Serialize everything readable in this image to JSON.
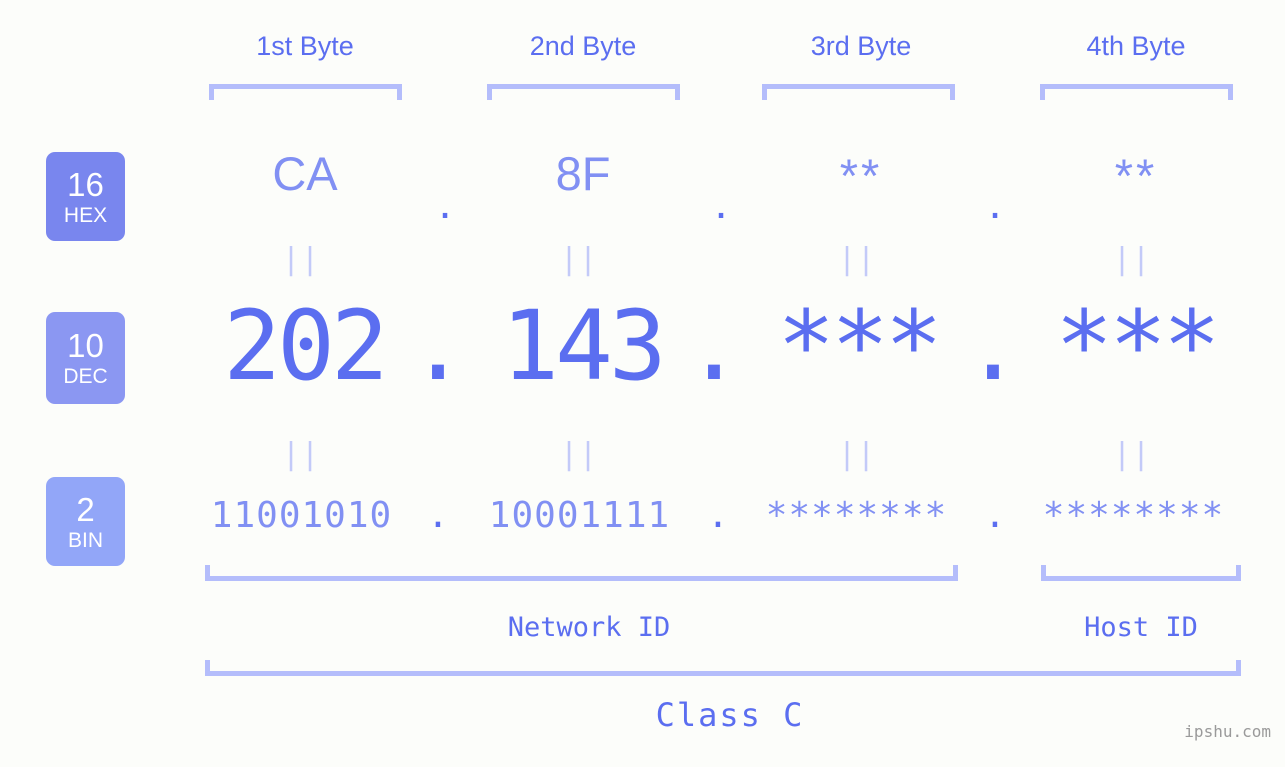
{
  "background_color": "#fcfdfa",
  "accent_color": "#5b6ef0",
  "accent_light_color": "#8190f3",
  "bracket_color": "#b4bdfb",
  "connector_color": "#c3caf8",
  "watermark": "ipshu.com",
  "headers": {
    "byte1": "1st Byte",
    "byte2": "2nd Byte",
    "byte3": "3rd Byte",
    "byte4": "4th Byte"
  },
  "radix_badges": [
    {
      "number": "16",
      "abbr": "HEX",
      "color": "#7986ee"
    },
    {
      "number": "10",
      "abbr": "DEC",
      "color": "#8b97f2"
    },
    {
      "number": "2",
      "abbr": "BIN",
      "color": "#92a6f8"
    }
  ],
  "rows": {
    "hex": {
      "byte1": "CA",
      "byte2": "8F",
      "byte3": "**",
      "byte4": "**",
      "sep1": ".",
      "sep2": ".",
      "sep3": "."
    },
    "dec": {
      "byte1": "202",
      "byte2": "143",
      "byte3": "***",
      "byte4": "***",
      "sep1": ".",
      "sep2": ".",
      "sep3": "."
    },
    "bin": {
      "byte1": "11001010",
      "byte2": "10001111",
      "byte3": "********",
      "byte4": "********",
      "sep1": ".",
      "sep2": ".",
      "sep3": "."
    }
  },
  "connectors": {
    "eq": "||"
  },
  "captions": {
    "network_id": "Network ID",
    "host_id": "Host ID",
    "class": "Class C"
  }
}
